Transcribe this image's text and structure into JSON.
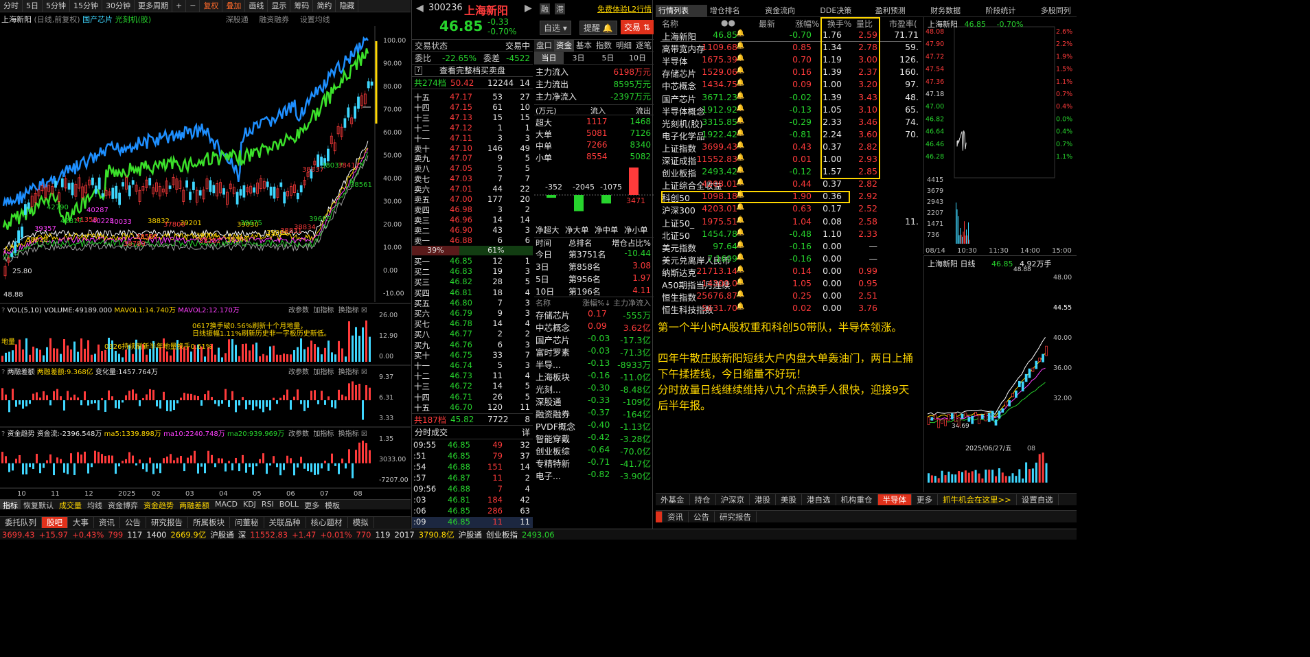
{
  "toolbar": {
    "periods": [
      "分时",
      "5日",
      "5分钟",
      "15分钟",
      "30分钟",
      "更多周期"
    ],
    "fq": "复权",
    "overlay": "叠加",
    "tools": [
      "画线",
      "显示",
      "筹码",
      "简约",
      "隐藏"
    ]
  },
  "chart_header": {
    "name": "上海新阳",
    "mode": "(日线,前复权)",
    "tag1": "国产芯片",
    "tag2": "光刻机(胶)",
    "links": [
      "深股通",
      "融资融券",
      "设置均线"
    ]
  },
  "chart_data": [
    {
      "type": "line",
      "title": "上海新阳 日线",
      "y_right_ticks": [
        "100.00",
        "90.00",
        "80.00",
        "70.00",
        "60.00",
        "50.00",
        "40.00",
        "30.00",
        "20.00",
        "10.00",
        "0.00",
        "-10.00"
      ],
      "annotations": [
        "48.88",
        "25.80",
        "38528",
        "39357",
        "42790",
        "42817",
        "41358",
        "40287",
        "40225",
        "40033",
        "38780",
        "38586",
        "38832",
        "37800",
        "39201",
        "39004",
        "38282",
        "38344",
        "39030",
        "39675",
        "39006",
        "38831",
        "38834",
        "39695",
        "38837",
        "38037",
        "38412",
        "38561"
      ],
      "x_ticks": [
        "10",
        "11",
        "12",
        "2025",
        "02",
        "03",
        "04",
        "05",
        "06",
        "07",
        "08"
      ]
    },
    {
      "type": "bar",
      "title": "VOL(5,10)",
      "labels": [
        "VOLUME:49189.000",
        "MAVOL1:14.740万",
        "MAVOL2:12.170万"
      ],
      "ticks": [
        "26.00",
        "12.90",
        "0.00"
      ],
      "notes": [
        "0617换手破0.56%刷新十个月地量，",
        "日线振幅1.11%刷新历史非一字板历史新低。",
        "0326持续刷新半年地量换手0.61%",
        "地量"
      ]
    },
    {
      "type": "bar",
      "title": "两融差额",
      "labels": [
        "两融差额:9.368亿",
        "变化量:1457.764万"
      ],
      "ticks": [
        "9.37",
        "6.31",
        "3.33"
      ]
    },
    {
      "type": "bar",
      "title": "资金趋势",
      "labels": [
        "资金流:-2396.548万",
        "ma5:1339.898万",
        "ma10:2240.748万",
        "ma20:939.969万"
      ],
      "ticks": [
        "1.35",
        "3033.00",
        "-7207.00"
      ]
    }
  ],
  "panel_buttons": [
    "改参数",
    "加指标",
    "换指标"
  ],
  "indicator_tabs": [
    "指标",
    "恢复默认",
    "成交量",
    "均线",
    "资金博弈",
    "资金趋势",
    "两融差额",
    "MACD",
    "KDJ",
    "RSI",
    "BOLL",
    "更多",
    "模板"
  ],
  "quote": {
    "code": "300236",
    "name": "上海新阳",
    "price": "46.85",
    "chg": "-0.33",
    "pct": "-0.70%",
    "btn1": "融",
    "btn2": "港",
    "l2": "免费体验L2行情",
    "zixuan": "自选",
    "tixing": "提醒",
    "trade": "交易"
  },
  "status": {
    "label": "交易状态",
    "value": "交易中",
    "weibi_l": "委比",
    "weibi": "-22.65%",
    "weicha_l": "委差",
    "weicha": "-4522",
    "full": "查看完整档买卖盘",
    "sell_total": "共274档",
    "sell_px": "50.42",
    "sell_vol": "12244",
    "sell_n": "14",
    "buy_total": "共187档",
    "buy_px": "45.82",
    "buy_vol": "7722",
    "buy_n": "8",
    "ratio_s": "39%",
    "ratio_b": "61%"
  },
  "asks": [
    [
      "十五",
      "47.17",
      "53",
      "27"
    ],
    [
      "十四",
      "47.15",
      "61",
      "10"
    ],
    [
      "十三",
      "47.13",
      "15",
      "15"
    ],
    [
      "十二",
      "47.12",
      "1",
      "1"
    ],
    [
      "十一",
      "47.11",
      "3",
      "3"
    ],
    [
      "卖十",
      "47.10",
      "146",
      "49"
    ],
    [
      "卖九",
      "47.07",
      "9",
      "5"
    ],
    [
      "卖八",
      "47.05",
      "5",
      "5"
    ],
    [
      "卖七",
      "47.03",
      "7",
      "7"
    ],
    [
      "卖六",
      "47.01",
      "44",
      "22"
    ],
    [
      "卖五",
      "47.00",
      "177",
      "20"
    ],
    [
      "卖四",
      "46.98",
      "3",
      "2"
    ],
    [
      "卖三",
      "46.96",
      "14",
      "14"
    ],
    [
      "卖二",
      "46.90",
      "43",
      "3"
    ],
    [
      "卖一",
      "46.88",
      "6",
      "6"
    ]
  ],
  "bids": [
    [
      "买一",
      "46.85",
      "12",
      "1"
    ],
    [
      "买二",
      "46.83",
      "19",
      "3"
    ],
    [
      "买三",
      "46.82",
      "28",
      "5"
    ],
    [
      "买四",
      "46.81",
      "18",
      "4"
    ],
    [
      "买五",
      "46.80",
      "7",
      "3"
    ],
    [
      "买六",
      "46.79",
      "9",
      "3"
    ],
    [
      "买七",
      "46.78",
      "14",
      "4"
    ],
    [
      "买八",
      "46.77",
      "2",
      "2"
    ],
    [
      "买九",
      "46.76",
      "6",
      "3"
    ],
    [
      "买十",
      "46.75",
      "33",
      "7"
    ],
    [
      "十一",
      "46.74",
      "5",
      "3"
    ],
    [
      "十二",
      "46.73",
      "11",
      "4"
    ],
    [
      "十三",
      "46.72",
      "14",
      "5"
    ],
    [
      "十四",
      "46.71",
      "26",
      "5"
    ],
    [
      "十五",
      "46.70",
      "120",
      "11"
    ]
  ],
  "ticks_title": "分时成交",
  "ticks_more": "详",
  "ticks": [
    [
      "09:55",
      "46.85",
      "49",
      "32"
    ],
    [
      ":51",
      "46.85",
      "79",
      "37"
    ],
    [
      ":54",
      "46.88",
      "151",
      "14"
    ],
    [
      ":57",
      "46.87",
      "11",
      "2"
    ],
    [
      "09:56",
      "46.88",
      "7",
      "4"
    ],
    [
      ":03",
      "46.81",
      "184",
      "42"
    ],
    [
      ":06",
      "46.85",
      "286",
      "63"
    ],
    [
      ":09",
      "46.85",
      "11",
      "11"
    ]
  ],
  "flow_tabs": [
    "盘口",
    "资金",
    "基本",
    "指数",
    "明细",
    "逐笔"
  ],
  "flow_days": [
    "当日",
    "3日",
    "5日",
    "10日"
  ],
  "flow": [
    [
      "主力流入",
      "6198万元"
    ],
    [
      "主力流出",
      "8595万元"
    ],
    [
      "主力净流入",
      "-2397万元"
    ]
  ],
  "flow_table": {
    "h": [
      "(万元)",
      "流入",
      "流出"
    ],
    "rows": [
      [
        "超大",
        "1117",
        "1468"
      ],
      [
        "大单",
        "5081",
        "7126"
      ],
      [
        "中单",
        "7266",
        "8340"
      ],
      [
        "小单",
        "8554",
        "5082"
      ]
    ]
  },
  "net_bars": {
    "values": [
      "-352",
      "-2045",
      "-1075",
      "3471"
    ],
    "labels": [
      "净超大",
      "净大单",
      "净中单",
      "净小单"
    ]
  },
  "rank": {
    "h": [
      "时间",
      "总排名",
      "增仓占比%"
    ],
    "rows": [
      [
        "今日",
        "第3751名",
        "-10.44"
      ],
      [
        "3日",
        "第858名",
        "3.08"
      ],
      [
        "5日",
        "第956名",
        "1.97"
      ],
      [
        "10日",
        "第196名",
        "4.11"
      ]
    ]
  },
  "concepts": {
    "h": [
      "名称",
      "涨幅%↓",
      "主力净流入"
    ],
    "rows": [
      [
        "存储芯片",
        "0.17",
        "-555万"
      ],
      [
        "中芯概念",
        "0.09",
        "3.62亿"
      ],
      [
        "国产芯片",
        "-0.03",
        "-17.3亿"
      ],
      [
        "富时罗素",
        "-0.03",
        "-71.3亿"
      ],
      [
        "半导...",
        "-0.13",
        "-8933万"
      ],
      [
        "上海板块",
        "-0.16",
        "-11.0亿"
      ],
      [
        "光刻...",
        "-0.30",
        "-8.48亿"
      ],
      [
        "深股通",
        "-0.33",
        "-109亿"
      ],
      [
        "融资融券",
        "-0.37",
        "-164亿"
      ],
      [
        "PVDF概念",
        "-0.40",
        "-1.13亿"
      ],
      [
        "智能穿戴",
        "-0.42",
        "-3.28亿"
      ],
      [
        "创业板综",
        "-0.64",
        "-70.0亿"
      ],
      [
        "专精特新",
        "-0.71",
        "-41.7亿"
      ],
      [
        "电子...",
        "-0.82",
        "-3.90亿"
      ]
    ]
  },
  "right_tabs": [
    "行情列表",
    "增仓排名",
    "资金流向",
    "DDE决策",
    "盈利预测",
    "财务数据",
    "阶段统计",
    "多股同列"
  ],
  "list_head": [
    "名称",
    "●●",
    "最新",
    "涨幅%",
    "换手%",
    "量比",
    "市盈率("
  ],
  "list": [
    [
      "上海新阳",
      "46.85",
      "-0.70",
      "1.76",
      "2.59",
      "71.71"
    ],
    [
      "高带宽内存",
      "1109.68",
      "0.85",
      "1.34",
      "2.78",
      "59."
    ],
    [
      "半导体",
      "1675.39",
      "0.70",
      "1.19",
      "3.00",
      "126."
    ],
    [
      "存储芯片",
      "1529.06",
      "0.16",
      "1.39",
      "2.37",
      "160."
    ],
    [
      "中芯概念",
      "1434.75",
      "0.09",
      "1.00",
      "3.20",
      "97."
    ],
    [
      "国产芯片",
      "3671.23",
      "-0.02",
      "1.39",
      "3.43",
      "48."
    ],
    [
      "半导体概念",
      "1912.92",
      "-0.13",
      "1.05",
      "3.10",
      "65."
    ],
    [
      "光刻机(胶)",
      "3315.85",
      "-0.29",
      "2.33",
      "3.46",
      "74."
    ],
    [
      "电子化学品",
      "1922.42",
      "-0.81",
      "2.24",
      "3.60",
      "70."
    ],
    [
      "上证指数",
      "3699.43",
      "0.43",
      "0.37",
      "2.82",
      ""
    ],
    [
      "深证成指",
      "11552.83",
      "0.01",
      "1.00",
      "2.93",
      ""
    ],
    [
      "创业板指",
      "2493.42",
      "-0.12",
      "1.57",
      "2.85",
      ""
    ],
    [
      "上证综合全收益",
      "4208.01",
      "0.44",
      "0.37",
      "2.82",
      ""
    ],
    [
      "科创50",
      "1098.18",
      "1.90",
      "0.36",
      "2.92",
      ""
    ],
    [
      "沪深300",
      "4203.01",
      "0.63",
      "0.17",
      "2.52",
      ""
    ],
    [
      "上证50_",
      "1975.51",
      "1.04",
      "0.08",
      "2.58",
      "11."
    ],
    [
      "北证50",
      "1454.78",
      "-0.48",
      "1.10",
      "2.33",
      ""
    ],
    [
      "美元指数",
      "97.64",
      "-0.16",
      "0.00",
      "—",
      ""
    ],
    [
      "美元兑离岸人民币",
      "7.1699",
      "-0.16",
      "0.00",
      "—",
      ""
    ],
    [
      "纳斯达克",
      "21713.14",
      "0.14",
      "0.00",
      "0.99",
      ""
    ],
    [
      "A50期指当月连续",
      "14300.0",
      "1.05",
      "0.00",
      "0.95",
      ""
    ],
    [
      "恒生指数",
      "25676.87",
      "0.25",
      "0.00",
      "2.51",
      ""
    ],
    [
      "恒生科技指数",
      "5631.70",
      "0.02",
      "0.00",
      "3.76",
      ""
    ]
  ],
  "note": [
    "第一个半小时A股权重和科创50带队，半导体领涨。",
    "四年牛散庄股新阳短线大户内盘大单轰油门，两日上捅下午揉搓线，今日缩量不好玩！",
    "分时放量日线继续维持八九个点换手人很快，迎接9天后半年报。"
  ],
  "mini": {
    "name": "上海新阳",
    "price": "46.85",
    "pct": "-0.70%",
    "left": [
      "48.08",
      "47.90",
      "47.72",
      "47.54",
      "47.36",
      "47.18",
      "47.00",
      "46.82",
      "46.64",
      "46.46",
      "46.28"
    ],
    "right": [
      "2.6%",
      "2.2%",
      "1.9%",
      "1.5%",
      "1.1%",
      "0.7%",
      "0.4%",
      "0.0%",
      "0.4%",
      "0.7%",
      "1.1%"
    ],
    "vol": [
      "4415",
      "3679",
      "2943",
      "2207",
      "1471",
      "736"
    ],
    "times": [
      "08/14",
      "10:30",
      "11:30",
      "14:00",
      "15:00"
    ]
  },
  "daily": {
    "name": "上海新阳",
    "mode": "日线",
    "price": "46.85",
    "turn": "4.92万手",
    "hi": "48.88",
    "lo": "34.69",
    "date": "2025/06/27/五",
    "x": "08",
    "ticks": [
      "48.00",
      "44.55",
      "40.00",
      "36.00",
      "32.00"
    ]
  },
  "bottom_tabs": [
    "委托队列",
    "股吧",
    "大事",
    "资讯",
    "公告",
    "研究报告",
    "所属板块",
    "问董秘",
    "关联品种",
    "核心题材",
    "模拟"
  ],
  "right_bottom_tabs": [
    "外基金",
    "持仓",
    "沪深京",
    "港股",
    "美股",
    "港自选",
    "机构重仓",
    "半导体",
    "更多",
    "抓牛机会在这里>>",
    "设置自选"
  ],
  "right_bottom2": [
    "资讯",
    "公告",
    "研究报告"
  ],
  "ticker": [
    "3699.43",
    "+15.97",
    "+0.43%",
    "799",
    "117",
    "1400",
    "2669.9亿",
    "沪股通",
    "深",
    "11552.83",
    "+1.47",
    "+0.01%",
    "770",
    "119",
    "2017",
    "3790.8亿",
    "沪股通",
    "创业板指",
    "2493.06"
  ],
  "colors": {
    "up": "#ff3b3b",
    "down": "#27d42d",
    "accent": "#ffd700",
    "blue": "#2aa5ff"
  }
}
